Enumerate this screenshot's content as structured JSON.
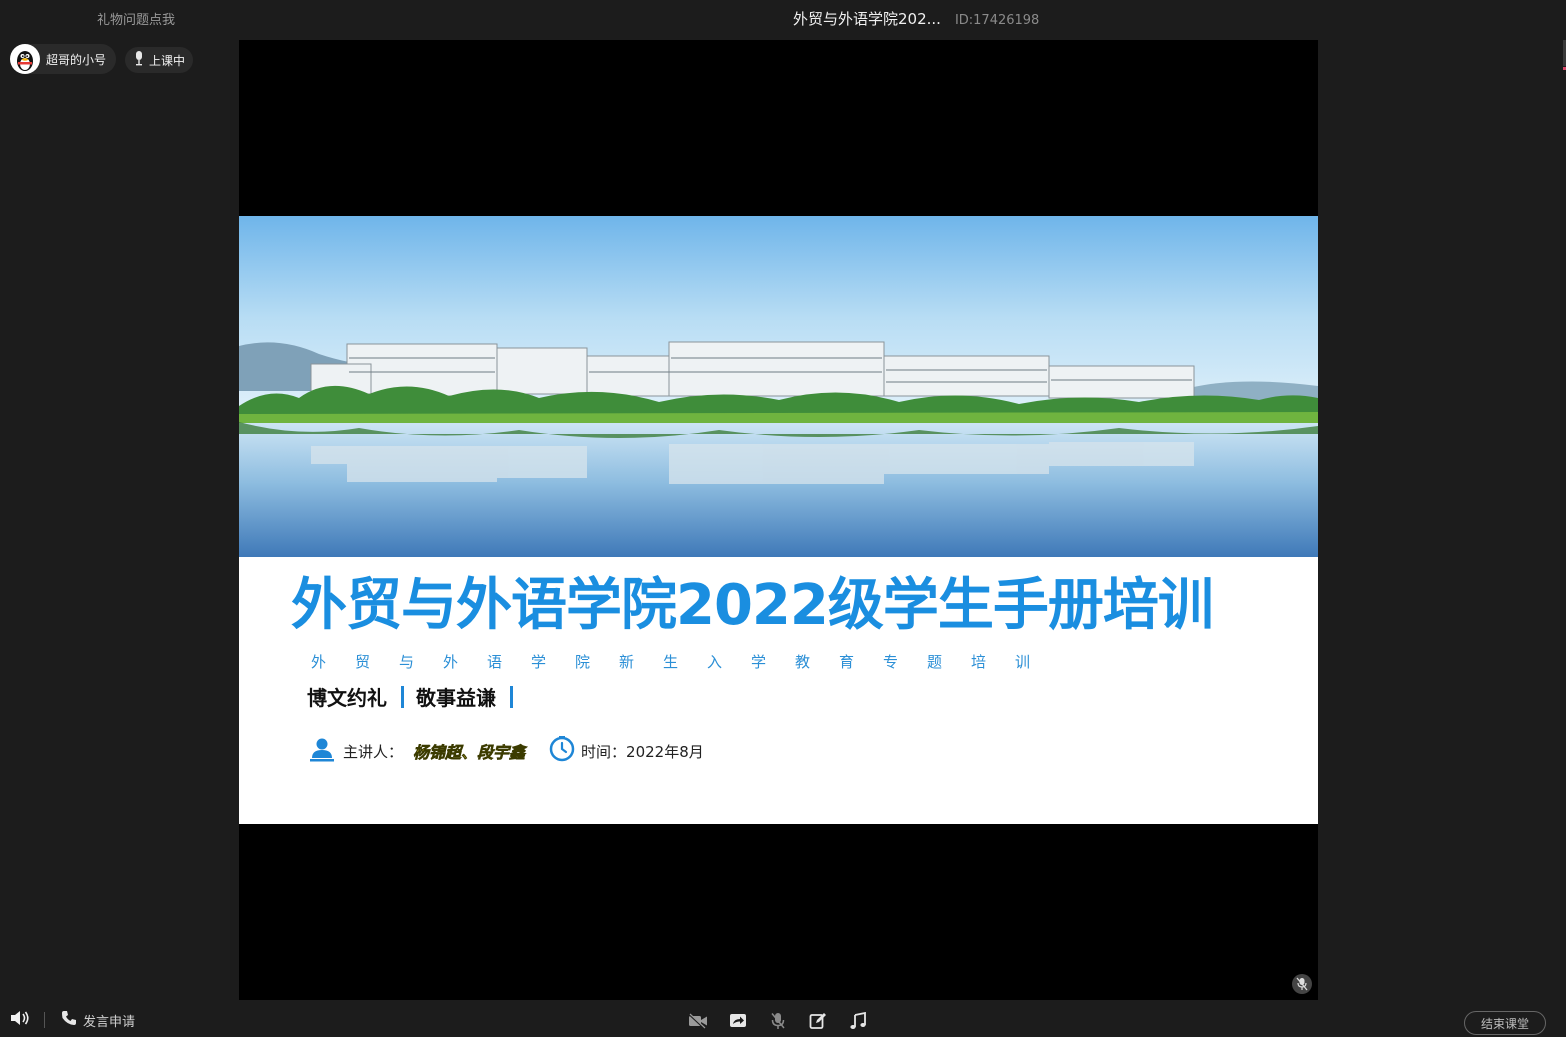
{
  "topbar": {
    "gift_link": "礼物问题点我",
    "room_title": "外贸与外语学院202...",
    "room_id": "ID:17426198"
  },
  "user": {
    "name": "超哥的小号",
    "status": "上课中"
  },
  "slide": {
    "title": "外贸与外语学院2022级学生手册培训",
    "subtitle": "外贸与外语学院新生入学教育专题培训",
    "motto_1": "博文约礼",
    "motto_2": "敬事益谦",
    "presenter_label": "主讲人：",
    "presenters": "杨锦超、段宇鑫",
    "time_label": "时间：",
    "time_value": "2022年8月"
  },
  "bottombar": {
    "raise_hand": "发言申请",
    "end_class": "结束课堂",
    "tools": [
      "camera-off-icon",
      "screen-share-icon",
      "mic-off-icon",
      "whiteboard-icon",
      "music-icon"
    ]
  },
  "colors": {
    "accent": "#1a8ee0",
    "background": "#1c1c1c",
    "stage": "#000000",
    "presenter_highlight": "#f5e23a"
  }
}
